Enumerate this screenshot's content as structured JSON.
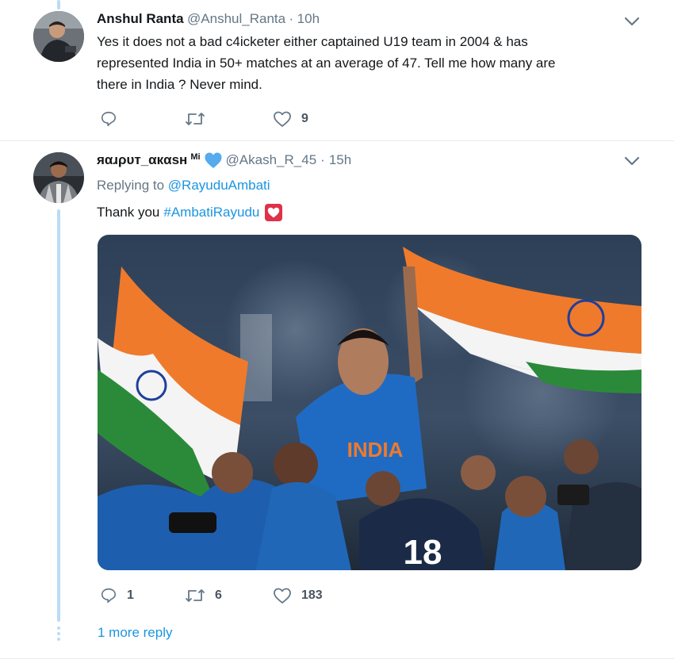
{
  "tweet1": {
    "display_name": "Anshul Ranta",
    "handle": "@Anshul_Ranta",
    "separator": "·",
    "time": "10h",
    "text_line1": "Yes it does not a bad c4icketer either captained U19 team in 2004 & has",
    "text_line2": "represented India in 50+ matches at an average of 47. Tell me how many are",
    "text_line3": "there in India ? Never mind.",
    "reply_count": "",
    "retweet_count": "",
    "like_count": "9"
  },
  "tweet2": {
    "display_name": "яαɹρυт_αкαѕн",
    "superscript": "Mi",
    "handle": "@Akash_R_45",
    "separator": "·",
    "time": "15h",
    "replying_prefix": "Replying to",
    "replying_to": "@RayuduAmbati",
    "text": "Thank you",
    "hashtag": "#AmbatiRayudu",
    "reply_count": "1",
    "retweet_count": "6",
    "like_count": "183",
    "jersey_text": "INDIA",
    "jersey_number": "18"
  },
  "more_reply": "1 more reply",
  "colors": {
    "accent": "#1b95e0",
    "thread": "#b9dcf5",
    "muted": "#657786"
  },
  "icons": [
    "chevron-down-icon",
    "reply-icon",
    "retweet-icon",
    "like-icon",
    "heart-emoji-icon",
    "blue-heart-emoji-icon"
  ]
}
